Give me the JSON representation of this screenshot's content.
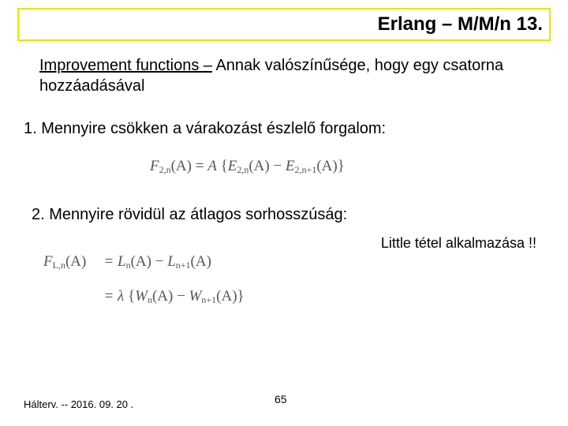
{
  "title": "Erlang – M/M/n  13.",
  "intro_underlined": "Improvement functions –",
  "intro_rest": " Annak valószínűsége, hogy egy csatorna hozzáadásával",
  "item1": "1. Mennyire csökken a várakozást észlelő forgalom:",
  "formula1": {
    "lhs_base": "F",
    "lhs_sub": "2,n",
    "lhs_arg": "(A)",
    "eq": " = ",
    "rhs_a": "A",
    "brace_open": " {",
    "t1_base": "E",
    "t1_sub": "2,n",
    "t1_arg": "(A)",
    "minus": " − ",
    "t2_base": "E",
    "t2_sub": "2,n+1",
    "t2_arg": "(A)",
    "brace_close": "}"
  },
  "item2": "2. Mennyire rövidül az átlagos sorhosszúság:",
  "note": "Little tétel alkalmazása !!",
  "formula2": {
    "row1": {
      "lhs_base": "F",
      "lhs_sub": "L,n",
      "lhs_arg": "(A)",
      "eq": "=",
      "t1_base": "L",
      "t1_sub": "n",
      "t1_arg": "(A)",
      "minus": " − ",
      "t2_base": "L",
      "t2_sub": "n+1",
      "t2_arg": "(A)"
    },
    "row2": {
      "eq": "=",
      "lambda": "λ ",
      "brace_open": "{",
      "t1_base": "W",
      "t1_sub": "n",
      "t1_arg": "(A)",
      "minus": " − ",
      "t2_base": "W",
      "t2_sub": "n+1",
      "t2_arg": "(A)",
      "brace_close": "}"
    }
  },
  "footer": "Hálterv. -- 2016. 09. 20 .",
  "page_number": "65"
}
